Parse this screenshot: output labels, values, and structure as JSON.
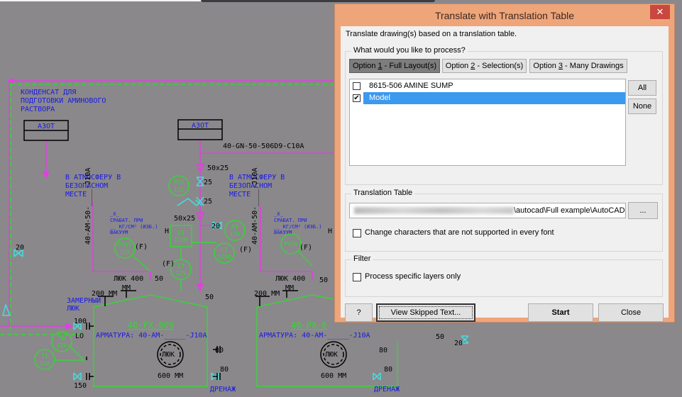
{
  "cad": {
    "labels": {
      "condensate": [
        "КОНДЕНСАТ ДЛЯ",
        "ПОДГОТОВКИ АМИНОВОГО",
        "РАСТВОРА"
      ],
      "nitrogen_box_1": "АЗОТ",
      "nitrogen_box_2": "АЗОТ",
      "line_tag": "40-GN-50-506D9-C10A",
      "atmosphere_1": [
        "В АТМОСФЕРУ В",
        "БЕЗОПАСНОМ",
        "МЕСТЕ"
      ],
      "atmosphere_2": [
        "В АТМОСФЕРУ В",
        "БЕЗОПАСНОМ",
        "МЕСТЕ"
      ],
      "reducer_1": "50x25",
      "reducer_2": "50x25",
      "valve_25a": "25",
      "valve_25b": "25",
      "valve_20": "20",
      "valve_20_left": "20",
      "pipe_vertical_1": "40-AM-50-____-J10A",
      "pipe_vertical_2": "40-AM-50-____-J10A",
      "psv_note_1": [
        "_X_",
        "СРАБАТ. ПРИ",
        "__ КГ/СМ² (ИЗБ.)",
        "ВАКУУМ"
      ],
      "psv_note_2": [
        "_X_",
        "СРАБАТ. ПРИ",
        "__ КГ/СМ² (ИЗБ.)",
        "ВАКУУМ"
      ],
      "hatch_400_1": "ЛЮК 400",
      "hatch_400_2": "ЛЮК 400",
      "mm": "ММ",
      "mm_200_1": "200 ММ",
      "mm_200_2": "200 ММ",
      "gauge_hatch": [
        "ЗАМЕРНЫЙ",
        "ЛЮК"
      ],
      "nozzle_50": "50",
      "nozzle_50b": "50",
      "f_mark": "(F)",
      "h_mark": "H",
      "tank_1_tag": "40-PX-009",
      "tank_2_tag": "40-PX-0",
      "fittings": "АРМАТУРА: 40-AM-_____-J10A",
      "manhole": "ЛЮК",
      "mm_600": "600 ММ",
      "n100": "100",
      "lo": "LO",
      "n150": "150",
      "n80a": "80",
      "n80b": "80",
      "drain": "ДРЕНАЖ",
      "n20_right": "20",
      "n50_right": "50"
    },
    "instruments": [
      {
        "tag": "PCV",
        "num": "132"
      },
      {
        "tag": "PI",
        "num": "134"
      },
      {
        "tag": "LI",
        "num": "119M"
      },
      {
        "tag": "LI",
        "num": "119B"
      },
      {
        "tag": "LT",
        "num": "119"
      },
      {
        "tag": "PVSV",
        "num": "131"
      },
      {
        "tag": "TW",
        "num": "120"
      },
      {
        "tag": "TI",
        "num": "120"
      }
    ]
  },
  "dialog": {
    "title": "Translate with Translation Table",
    "close_label": "✕",
    "description": "Translate drawing(s) based on a translation table.",
    "process_group": {
      "title": "What would you like to process?",
      "tabs": [
        {
          "prefix": "Option ",
          "key": "1",
          "suffix": " - Full Layout(s)",
          "active": true
        },
        {
          "prefix": "Option ",
          "key": "2",
          "suffix": " - Selection(s)",
          "active": false
        },
        {
          "prefix": "Option ",
          "key": "3",
          "suffix": " - Many Drawings",
          "active": false
        }
      ],
      "items": [
        {
          "label": "8615-506 AMINE SUMP",
          "checked": false,
          "selected": false
        },
        {
          "label": "Model",
          "checked": true,
          "selected": true
        }
      ],
      "all_label": "All",
      "none_label": "None"
    },
    "translation_group": {
      "title": "Translation Table",
      "path_visible": "\\autocad\\Full example\\AutoCAD",
      "browse_label": "...",
      "change_chars_label": "Change characters that are not supported in every font",
      "change_chars_checked": false
    },
    "filter_group": {
      "title": "Filter",
      "layers_label": "Process specific layers only",
      "layers_checked": false
    },
    "buttons": {
      "help": "?",
      "view_skipped": "View Skipped Text...",
      "start": "Start",
      "close": "Close"
    }
  }
}
